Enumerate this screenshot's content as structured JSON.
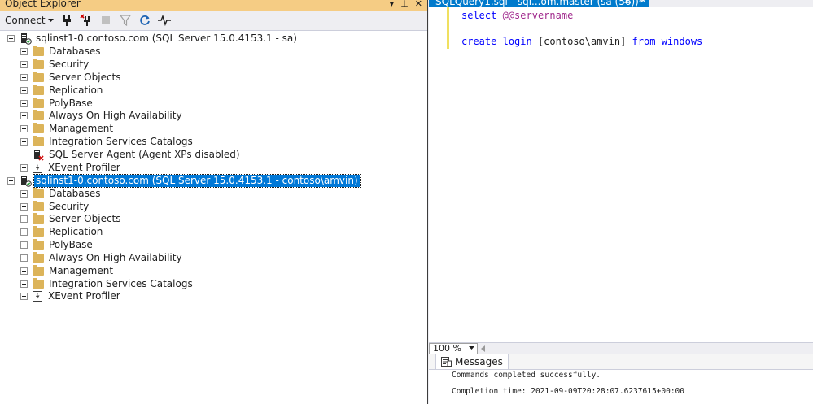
{
  "object_explorer": {
    "title": "Object Explorer",
    "title_buttons": [
      "▾",
      "⊥",
      "✕"
    ],
    "toolbar": {
      "connect_label": "Connect"
    },
    "servers": [
      {
        "label": "sqlinst1-0.contoso.com (SQL Server 15.0.4153.1 - sa)",
        "selected": false,
        "children": [
          "Databases",
          "Security",
          "Server Objects",
          "Replication",
          "PolyBase",
          "Always On High Availability",
          "Management",
          "Integration Services Catalogs"
        ],
        "agent": "SQL Server Agent (Agent XPs disabled)",
        "xevent": "XEvent Profiler"
      },
      {
        "label": "sqlinst1-0.contoso.com (SQL Server 15.0.4153.1 - contoso\\amvin)",
        "selected": true,
        "children": [
          "Databases",
          "Security",
          "Server Objects",
          "Replication",
          "PolyBase",
          "Always On High Availability",
          "Management",
          "Integration Services Catalogs"
        ],
        "xevent": "XEvent Profiler"
      }
    ]
  },
  "editor": {
    "tab_title": "SQLQuery1.sql - sql...om.master (sa (56))*",
    "tab_buttons": [
      "⊥",
      "✕"
    ],
    "lines": {
      "l1_kw": "select",
      "l1_var": "@@servername",
      "l3_kw1": "create",
      "l3_kw2": "login",
      "l3_plain": "[contoso\\amvin]",
      "l3_kw3": "from",
      "l3_kw4": "windows"
    }
  },
  "zoom": {
    "value": "100 %"
  },
  "messages": {
    "tab_label": "Messages",
    "line1": "Commands completed successfully.",
    "line2": "",
    "line3": "Completion time: 2021-09-09T20:28:07.6237615+00:00"
  },
  "colors": {
    "title_bar": "#f5cc84",
    "tab_active": "#007acc",
    "selection": "#0078d7",
    "keyword": "#0000ff",
    "variable": "#a0288c",
    "folder": "#dcb45a"
  }
}
